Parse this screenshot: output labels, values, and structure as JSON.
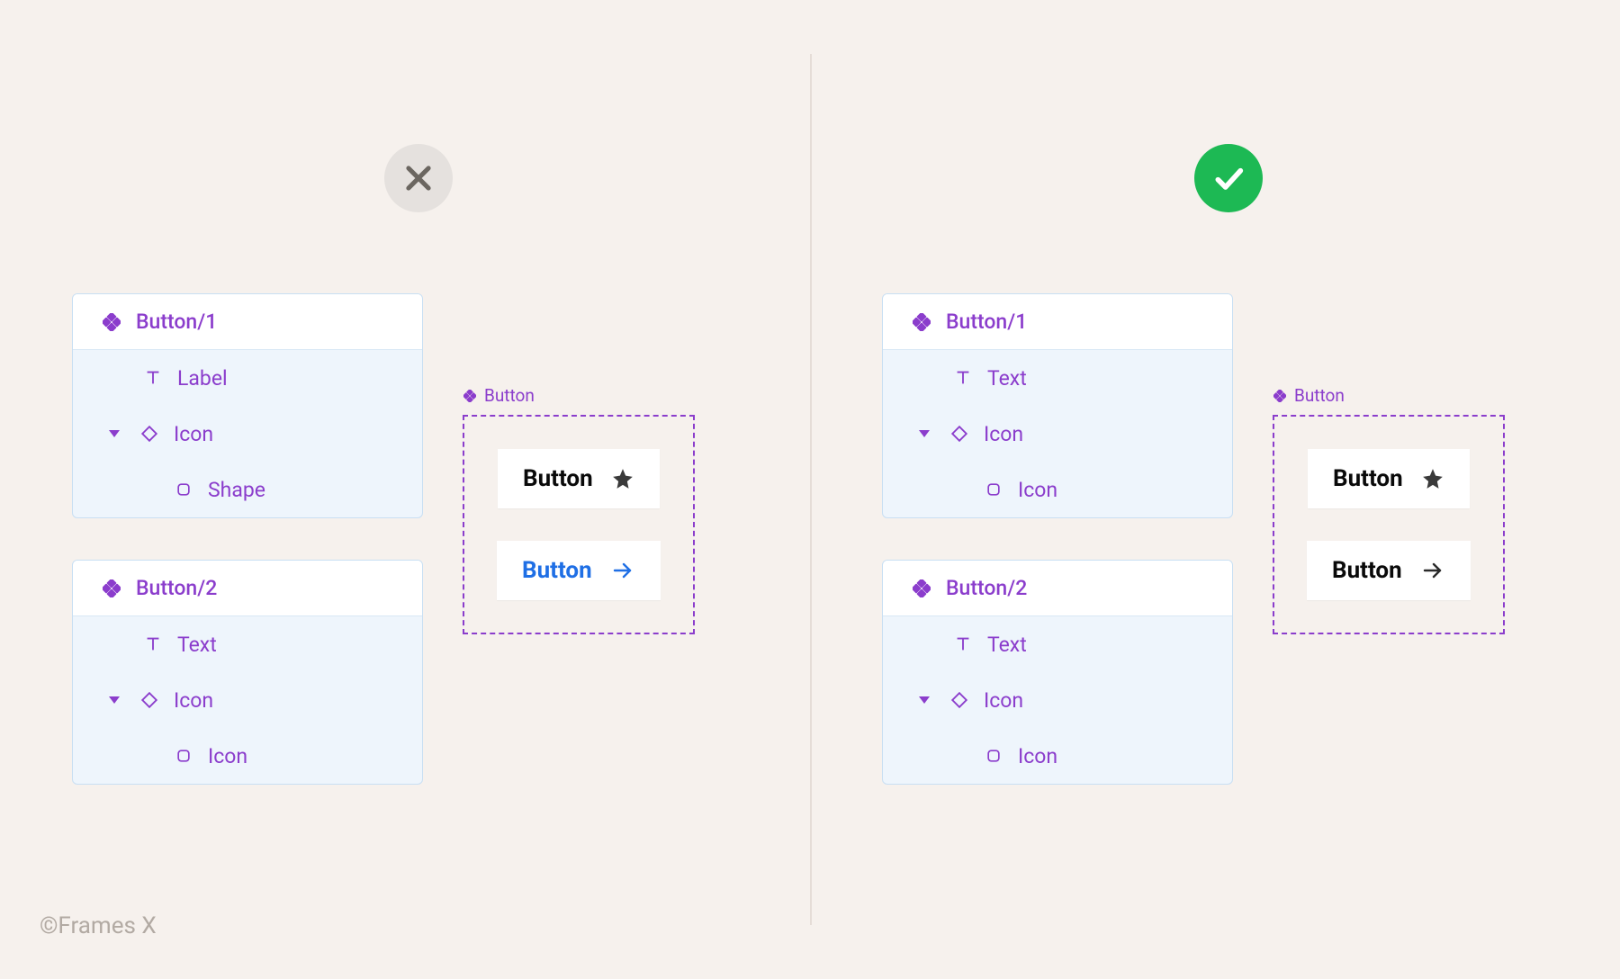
{
  "credit": "©Frames X",
  "colors": {
    "purple": "#8b3dcc",
    "success": "#1db954",
    "muted": "#e5e1de",
    "blue": "#1f6fe5"
  },
  "left": {
    "status": "wrong",
    "panels": [
      {
        "header": "Button/1",
        "rows": [
          {
            "icon": "text",
            "label": "Label",
            "indent": 1
          },
          {
            "icon": "diamond",
            "label": "Icon",
            "indent": 1,
            "chevron": true
          },
          {
            "icon": "square",
            "label": "Shape",
            "indent": 2
          }
        ]
      },
      {
        "header": "Button/2",
        "rows": [
          {
            "icon": "text",
            "label": "Text",
            "indent": 1
          },
          {
            "icon": "diamond",
            "label": "Icon",
            "indent": 1,
            "chevron": true
          },
          {
            "icon": "square",
            "label": "Icon",
            "indent": 2
          }
        ]
      }
    ],
    "preview": {
      "label": "Button",
      "buttons": [
        {
          "text": "Button",
          "icon": "star",
          "style": "dark"
        },
        {
          "text": "Button",
          "icon": "arrow",
          "style": "blue"
        }
      ]
    }
  },
  "right": {
    "status": "correct",
    "panels": [
      {
        "header": "Button/1",
        "rows": [
          {
            "icon": "text",
            "label": "Text",
            "indent": 1
          },
          {
            "icon": "diamond",
            "label": "Icon",
            "indent": 1,
            "chevron": true
          },
          {
            "icon": "square",
            "label": "Icon",
            "indent": 2
          }
        ]
      },
      {
        "header": "Button/2",
        "rows": [
          {
            "icon": "text",
            "label": "Text",
            "indent": 1
          },
          {
            "icon": "diamond",
            "label": "Icon",
            "indent": 1,
            "chevron": true
          },
          {
            "icon": "square",
            "label": "Icon",
            "indent": 2
          }
        ]
      }
    ],
    "preview": {
      "label": "Button",
      "buttons": [
        {
          "text": "Button",
          "icon": "star",
          "style": "dark"
        },
        {
          "text": "Button",
          "icon": "arrow",
          "style": "dark"
        }
      ]
    }
  }
}
